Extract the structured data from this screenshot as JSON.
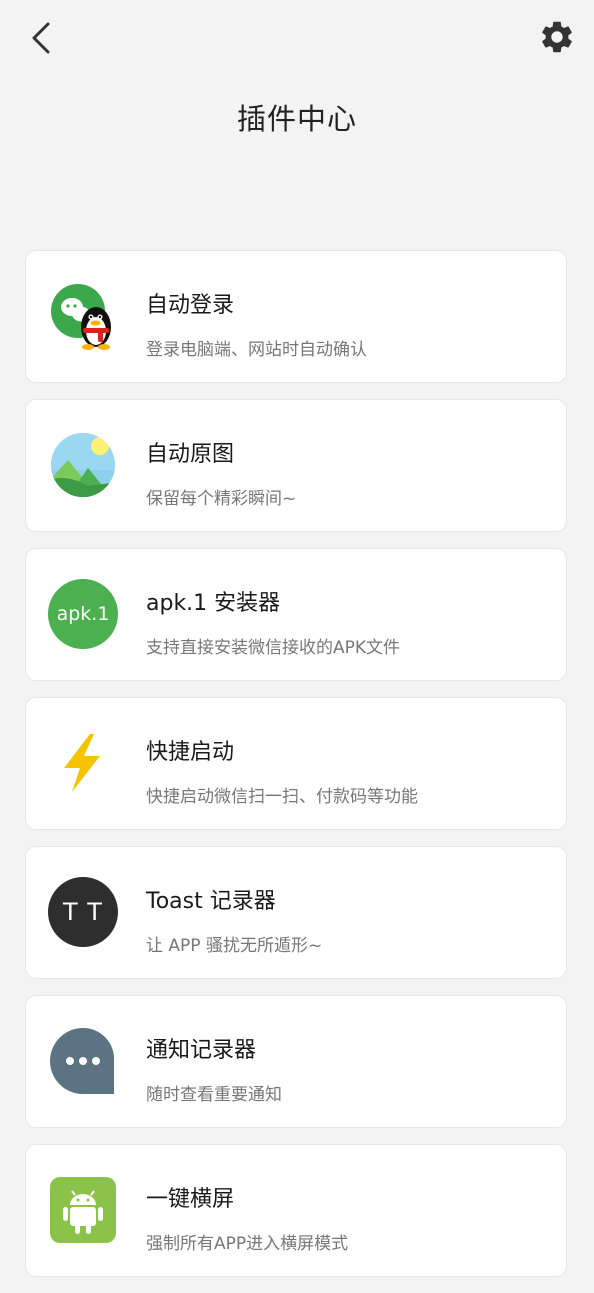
{
  "header": {
    "title": "插件中心",
    "back_icon": "chevron-left-icon",
    "settings_icon": "gear-icon"
  },
  "plugins": [
    {
      "title": "自动登录",
      "subtitle": "登录电脑端、网站时自动确认",
      "icon": "wechat-qq-icon"
    },
    {
      "title": "自动原图",
      "subtitle": "保留每个精彩瞬间~",
      "icon": "landscape-photo-icon"
    },
    {
      "title": "apk.1 安装器",
      "subtitle": "支持直接安装微信接收的APK文件",
      "icon": "apk-icon",
      "icon_text": "apk.1"
    },
    {
      "title": "快捷启动",
      "subtitle": "快捷启动微信扫一扫、付款码等功能",
      "icon": "lightning-icon"
    },
    {
      "title": "Toast 记录器",
      "subtitle": "让 APP 骚扰无所遁形~",
      "icon": "toast-icon",
      "icon_text": "T T"
    },
    {
      "title": "通知记录器",
      "subtitle": "随时查看重要通知",
      "icon": "chat-bubble-icon"
    },
    {
      "title": "一键横屏",
      "subtitle": "强制所有APP进入横屏模式",
      "icon": "android-icon"
    }
  ],
  "colors": {
    "background": "#f3f3f3",
    "wechat_green": "#3aa84b",
    "apk_green": "#4caf50",
    "lightning_yellow": "#f5c400",
    "toast_dark": "#2e2e2e",
    "notify_slate": "#5b7382",
    "android_green": "#8bc34a"
  }
}
